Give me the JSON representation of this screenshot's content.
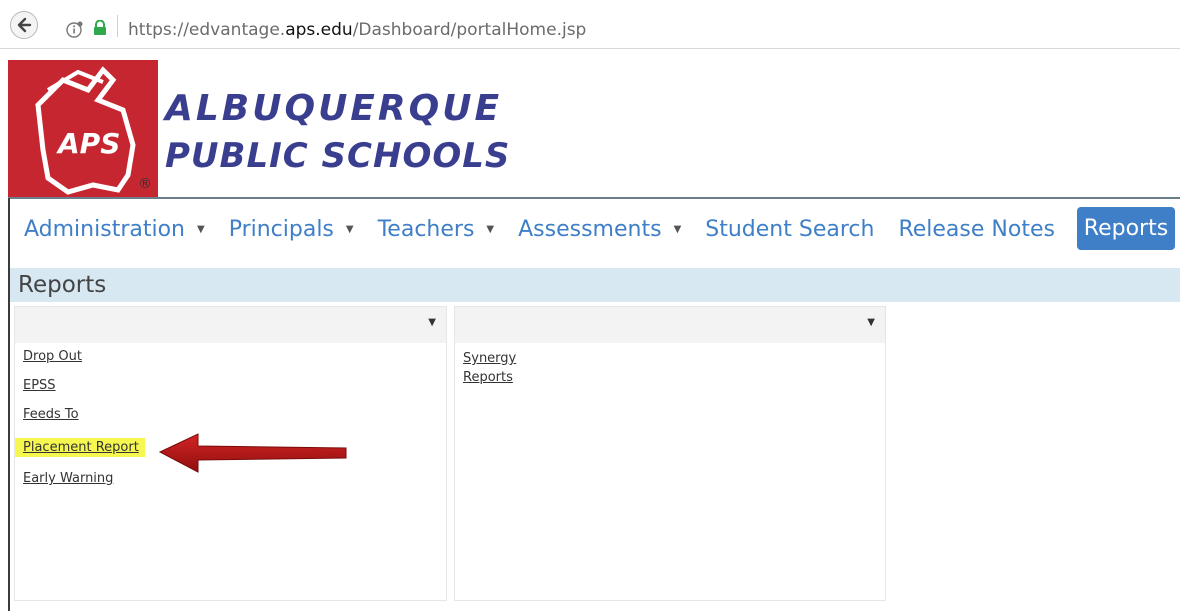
{
  "browser": {
    "url_prefix": "https://edvantage.",
    "url_domain": "aps.edu",
    "url_path": "/Dashboard/portalHome.jsp"
  },
  "logo": {
    "badge_text": "APS",
    "line1": "ALBUQUERQUE",
    "line2": "PUBLIC SCHOOLS",
    "registered": "®"
  },
  "nav": {
    "items": [
      {
        "label": "Administration",
        "dropdown": true
      },
      {
        "label": "Principals",
        "dropdown": true
      },
      {
        "label": "Teachers",
        "dropdown": true
      },
      {
        "label": "Assessments",
        "dropdown": true
      },
      {
        "label": "Student Search",
        "dropdown": false
      },
      {
        "label": "Release Notes",
        "dropdown": false
      }
    ],
    "active": "Reports"
  },
  "reports": {
    "title": "Reports",
    "left_links": [
      "Drop Out",
      "EPSS",
      "Feeds To",
      "Placement Report",
      "Early Warning"
    ],
    "right_link_line1": "Synergy",
    "right_link_line2": "Reports"
  },
  "colors": {
    "nav_link": "#3f7fc7",
    "active_tab": "#3f7fc7",
    "reports_bar": "#d7e8f3",
    "highlight": "#f6f74f",
    "arrow": "#c21a1a",
    "logo_red": "#c62630",
    "logo_text": "#3a3e8f"
  }
}
